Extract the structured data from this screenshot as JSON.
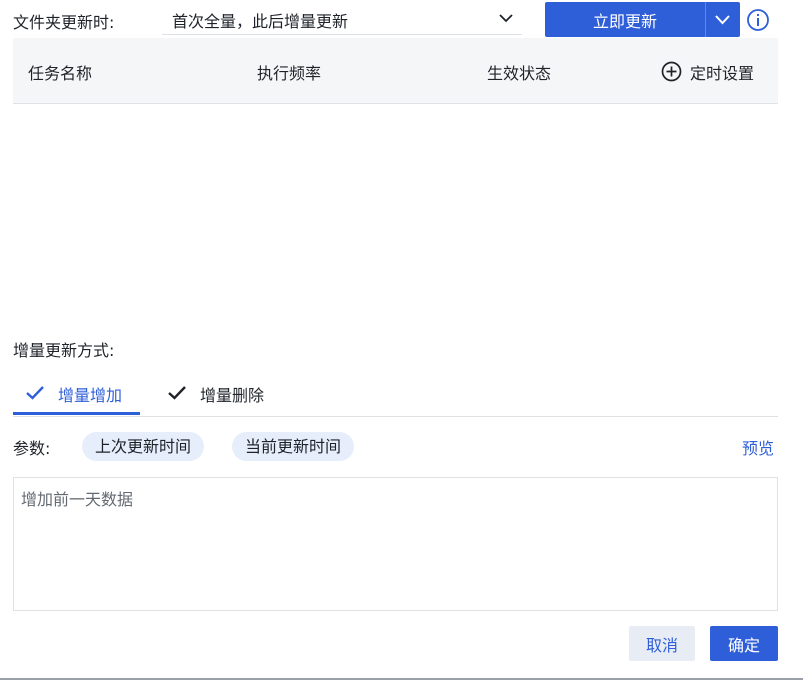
{
  "folder_update": {
    "label": "文件夹更新时:",
    "mode_value": "首次全量，此后增量更新",
    "update_now_label": "立即更新"
  },
  "task_table": {
    "columns": [
      "任务名称",
      "执行频率",
      "生效状态"
    ],
    "timer_setting_label": "定时设置"
  },
  "incremental": {
    "label": "增量更新方式:",
    "tabs": [
      {
        "label": "增量增加",
        "active": true
      },
      {
        "label": "增量删除",
        "active": false
      }
    ]
  },
  "params": {
    "label": "参数:",
    "chips": [
      "上次更新时间",
      "当前更新时间"
    ],
    "preview_label": "预览"
  },
  "editor": {
    "value": "增加前一天数据"
  },
  "footer": {
    "cancel_label": "取消",
    "ok_label": "确定"
  },
  "colors": {
    "accent": "#2f5fd8",
    "chip_bg": "#e6eefc",
    "header_bg": "#f5f6f7",
    "border": "#dfe1e5"
  },
  "icons": [
    "chevron-down-icon",
    "info-icon",
    "plus-circle-icon",
    "check-icon"
  ]
}
